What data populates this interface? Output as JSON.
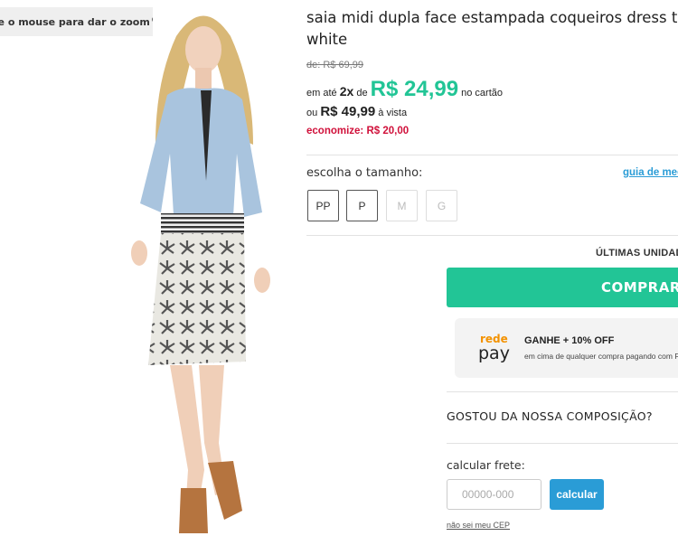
{
  "gallery": {
    "zoom_hint": "se o mouse para dar o zoom",
    "zoom_icon": "magnifier-plus-icon"
  },
  "product": {
    "title_line1": "saia midi dupla face estampada coqueiros dress to c",
    "title_line2": "white"
  },
  "pricing": {
    "old_price": "de: R$ 69,99",
    "installment_prefix": "em até",
    "installment_count": "2x",
    "installment_of": "de",
    "installment_amount": "R$ 24,99",
    "installment_suffix": "no cartão",
    "cash_prefix": "ou",
    "cash_amount": "R$ 49,99",
    "cash_suffix": "à vista",
    "savings": "economize: R$ 20,00",
    "accent_color": "#22c596",
    "savings_color": "#d0103a"
  },
  "sizes": {
    "label": "escolha o tamanho:",
    "guide_link": "guia de med",
    "options": [
      {
        "label": "PP",
        "available": true
      },
      {
        "label": "P",
        "available": true
      },
      {
        "label": "M",
        "available": false
      },
      {
        "label": "G",
        "available": false
      }
    ]
  },
  "purchase": {
    "stock_notice": "ÚLTIMAS UNIDAD",
    "buy_button": "COMPRAR"
  },
  "redepay": {
    "logo_top": "rede",
    "logo_bottom": "pay",
    "headline": "GANHE + 10% OFF",
    "subtext": "em cima de qualquer compra pagando com Re"
  },
  "composition": {
    "heading": "GOSTOU DA NOSSA COMPOSIÇÃO?"
  },
  "shipping": {
    "label": "calcular frete:",
    "cep_placeholder": "00000-000",
    "calc_button": "calcular",
    "no_cep_link": "não sei meu CEP",
    "button_color": "#2a9cd6"
  }
}
